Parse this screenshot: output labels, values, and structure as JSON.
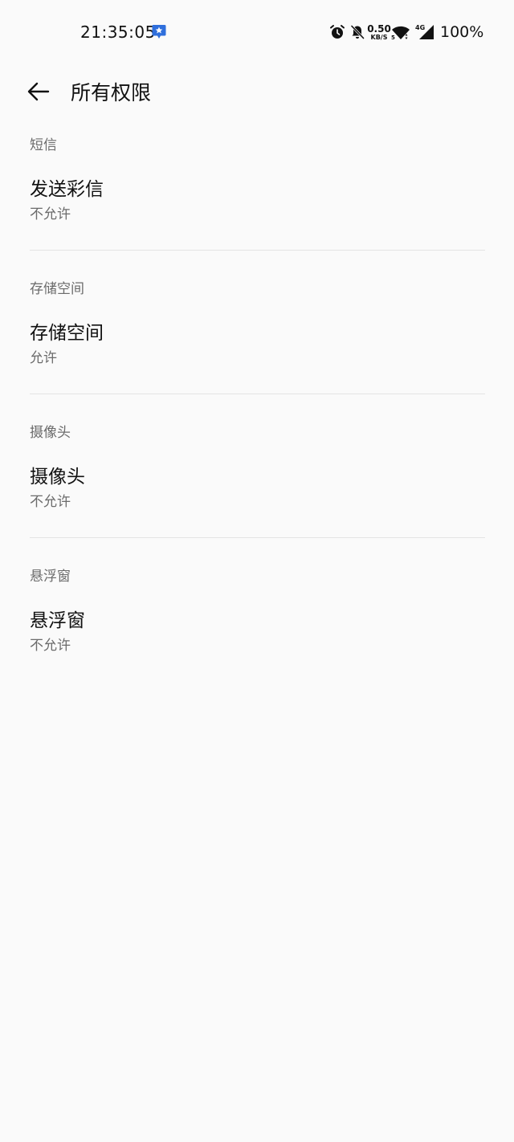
{
  "status_bar": {
    "time": "21:35:05",
    "net_speed_value": "0.50",
    "net_speed_unit": "KB/S",
    "signal_label": "4G",
    "wifi_badge": "5",
    "battery": "100%",
    "icons": [
      "notification-app-icon",
      "alarm-icon",
      "mute-bell-icon",
      "wifi-icon",
      "cell-signal-icon"
    ]
  },
  "app_bar": {
    "title": "所有权限",
    "back_icon": "back-arrow-icon"
  },
  "sections": [
    {
      "header": "短信",
      "item_title": "发送彩信",
      "item_status": "不允许"
    },
    {
      "header": "存储空间",
      "item_title": "存储空间",
      "item_status": "允许"
    },
    {
      "header": "摄像头",
      "item_title": "摄像头",
      "item_status": "不允许"
    },
    {
      "header": "悬浮窗",
      "item_title": "悬浮窗",
      "item_status": "不允许"
    }
  ],
  "colors": {
    "background": "#fafafa",
    "primary_text": "#111111",
    "secondary_text": "#6b6b6b",
    "divider": "#e4e4e4",
    "notif_accent": "#2f6fdc"
  }
}
